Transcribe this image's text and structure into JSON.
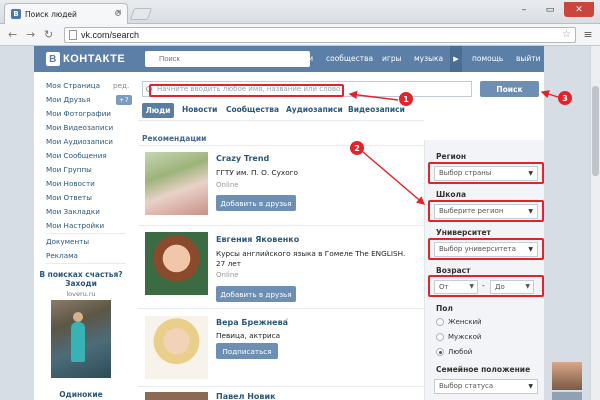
{
  "browser": {
    "tab_title": "Поиск людей",
    "tab_favicon": "В",
    "url": "vk.com/search"
  },
  "header": {
    "logo": "КОНТАКТЕ",
    "logo_letter": "В",
    "search_placeholder": "Поиск",
    "nav": [
      "люди",
      "сообщества",
      "игры",
      "музыка",
      "помощь",
      "выйти"
    ]
  },
  "left_menu": {
    "items": [
      "Моя Страница",
      "Мои Друзья",
      "Мои Фотографии",
      "Мои Видеозаписи",
      "Мои Аудиозаписи",
      "Мои Сообщения",
      "Мои Группы",
      "Мои Новости",
      "Мои Ответы",
      "Мои Закладки",
      "Мои Настройки"
    ],
    "edit_label": "ред.",
    "friends_badge": "+7",
    "extra": [
      "Документы",
      "Реклама"
    ],
    "promo_title": "В поисках счастья? Заходи",
    "promo_site": "loveru.ru",
    "promo_bottom": "Одинокие"
  },
  "search": {
    "placeholder": "Начните вводить любое имя, название или слово",
    "button": "Поиск",
    "tabs": [
      "Люди",
      "Новости",
      "Сообщества",
      "Аудиозаписи",
      "Видеозаписи"
    ],
    "section_title": "Рекомендации"
  },
  "people": [
    {
      "name": "Crazy Trend",
      "line1": "ГГТУ им. П. О. Сухого",
      "line2": "",
      "status": "Online",
      "button": "Добавить в друзья"
    },
    {
      "name": "Евгения Яковенко",
      "line1": "Курсы английского языка в Гомеле The ENGLISH.",
      "line2": "27 лет",
      "status": "Online",
      "button": "Добавить в друзья"
    },
    {
      "name": "Вера Брежнева",
      "line1": "Певица, актриса",
      "line2": "",
      "status": "",
      "button": "Подписаться",
      "verified": "✓"
    },
    {
      "name": "Павел Новик",
      "line1": "",
      "line2": "",
      "status": "",
      "button": ""
    }
  ],
  "filters": {
    "region_label": "Регион",
    "region_value": "Выбор страны",
    "school_label": "Школа",
    "school_value": "Выберите регион",
    "university_label": "Университет",
    "university_value": "Выбор университета",
    "age_label": "Возраст",
    "age_from": "От",
    "age_dash": "-",
    "age_to": "До",
    "gender_label": "Пол",
    "gender_options": [
      "Женский",
      "Мужской",
      "Любой"
    ],
    "gender_selected": "Любой",
    "marital_label": "Семейное положение",
    "marital_value": "Выбор статуса"
  },
  "annotations": [
    "1",
    "2",
    "3"
  ],
  "colors": {
    "vk_blue": "#5b7fa6",
    "button_blue": "#6d8fb3",
    "annotation_red": "#e2232a"
  }
}
